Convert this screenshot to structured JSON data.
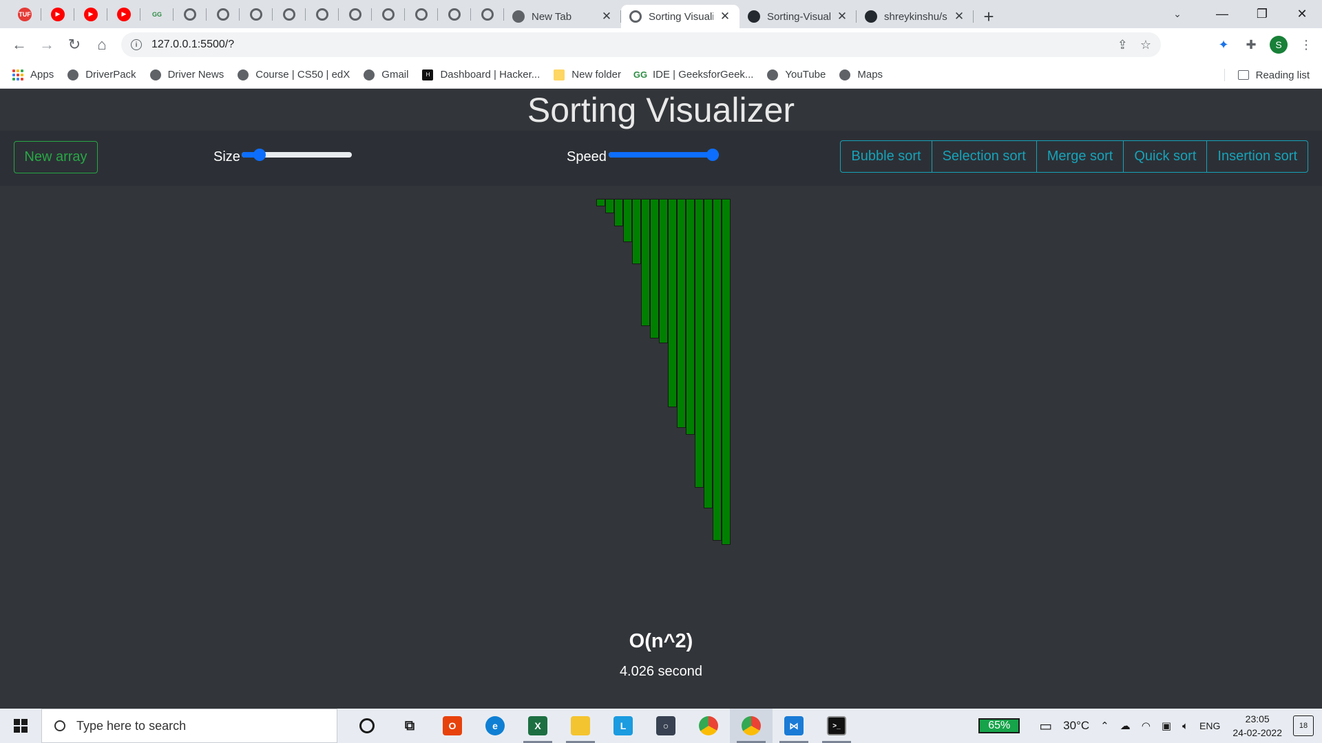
{
  "browser": {
    "pinned_tabs": [
      {
        "icon": "tuf-icon",
        "color": "#e53935",
        "text": "TUF"
      },
      {
        "icon": "youtube-icon",
        "color": "#ff0000",
        "text": "▶"
      },
      {
        "icon": "youtube-icon",
        "color": "#ff0000",
        "text": "▶"
      },
      {
        "icon": "youtube-icon",
        "color": "#ff0000",
        "text": "▶"
      },
      {
        "icon": "geeksforgeeks-icon",
        "color": "#2f8d46",
        "text": "GG"
      },
      {
        "icon": "globe-icon",
        "color": "#5f6368",
        "text": ""
      },
      {
        "icon": "globe-icon",
        "color": "#5f6368",
        "text": ""
      },
      {
        "icon": "globe-icon",
        "color": "#5f6368",
        "text": ""
      },
      {
        "icon": "globe-icon",
        "color": "#5f6368",
        "text": ""
      },
      {
        "icon": "globe-icon",
        "color": "#5f6368",
        "text": ""
      },
      {
        "icon": "globe-icon",
        "color": "#5f6368",
        "text": ""
      },
      {
        "icon": "globe-icon",
        "color": "#5f6368",
        "text": ""
      },
      {
        "icon": "globe-icon",
        "color": "#5f6368",
        "text": ""
      },
      {
        "icon": "globe-icon",
        "color": "#5f6368",
        "text": ""
      },
      {
        "icon": "globe-icon",
        "color": "#5f6368",
        "text": ""
      }
    ],
    "tabs": [
      {
        "title": "New Tab",
        "icon": "chrome-icon",
        "active": false
      },
      {
        "title": "Sorting Visualizer",
        "icon": "globe-icon",
        "active": true
      },
      {
        "title": "Sorting-Visualizatio",
        "icon": "github-icon",
        "active": false
      },
      {
        "title": "shreykinshu/sorting",
        "icon": "github-icon",
        "active": false
      }
    ],
    "new_tab_label": "+",
    "url": "127.0.0.1:5500/?",
    "bookmarks": [
      {
        "label": "Apps",
        "icon": "apps-grid-icon"
      },
      {
        "label": "DriverPack",
        "icon": "globe-icon"
      },
      {
        "label": "Driver News",
        "icon": "globe-icon"
      },
      {
        "label": "Course | CS50 | edX",
        "icon": "globe-icon"
      },
      {
        "label": "Gmail",
        "icon": "globe-icon"
      },
      {
        "label": "Dashboard | Hacker...",
        "icon": "hackerrank-icon"
      },
      {
        "label": "New folder",
        "icon": "folder-icon"
      },
      {
        "label": "IDE | GeeksforGeek...",
        "icon": "geeksforgeeks-icon"
      },
      {
        "label": "YouTube",
        "icon": "globe-icon"
      },
      {
        "label": "Maps",
        "icon": "globe-icon"
      }
    ],
    "reading_list": "Reading list",
    "profile_initial": "S"
  },
  "app": {
    "title": "Sorting Visualizer",
    "new_array_label": "New array",
    "size_label": "Size",
    "size_level": 0.12,
    "speed_label": "Speed",
    "speed_level": 1.0,
    "sort_buttons": [
      "Bubble sort",
      "Selection sort",
      "Merge sort",
      "Quick sort",
      "Insertion sort"
    ],
    "complexity": "O(n^2)",
    "time_taken": "4.026 second",
    "colors": {
      "bar": "#008000",
      "new_array": "#28a745",
      "sort_buttons": "#17a2b8",
      "slider": "#0d6efd"
    }
  },
  "chart_data": {
    "type": "bar",
    "orientation": "hanging",
    "values": [
      11,
      21,
      40,
      63,
      95,
      185,
      203,
      210,
      303,
      333,
      343,
      420,
      450,
      497,
      503
    ],
    "ylim": [
      0,
      520
    ]
  },
  "taskbar": {
    "search_placeholder": "Type here to search",
    "battery": "65%",
    "temperature": "30°C",
    "language": "ENG",
    "time": "23:05",
    "date": "24-02-2022",
    "notifications": "18"
  }
}
